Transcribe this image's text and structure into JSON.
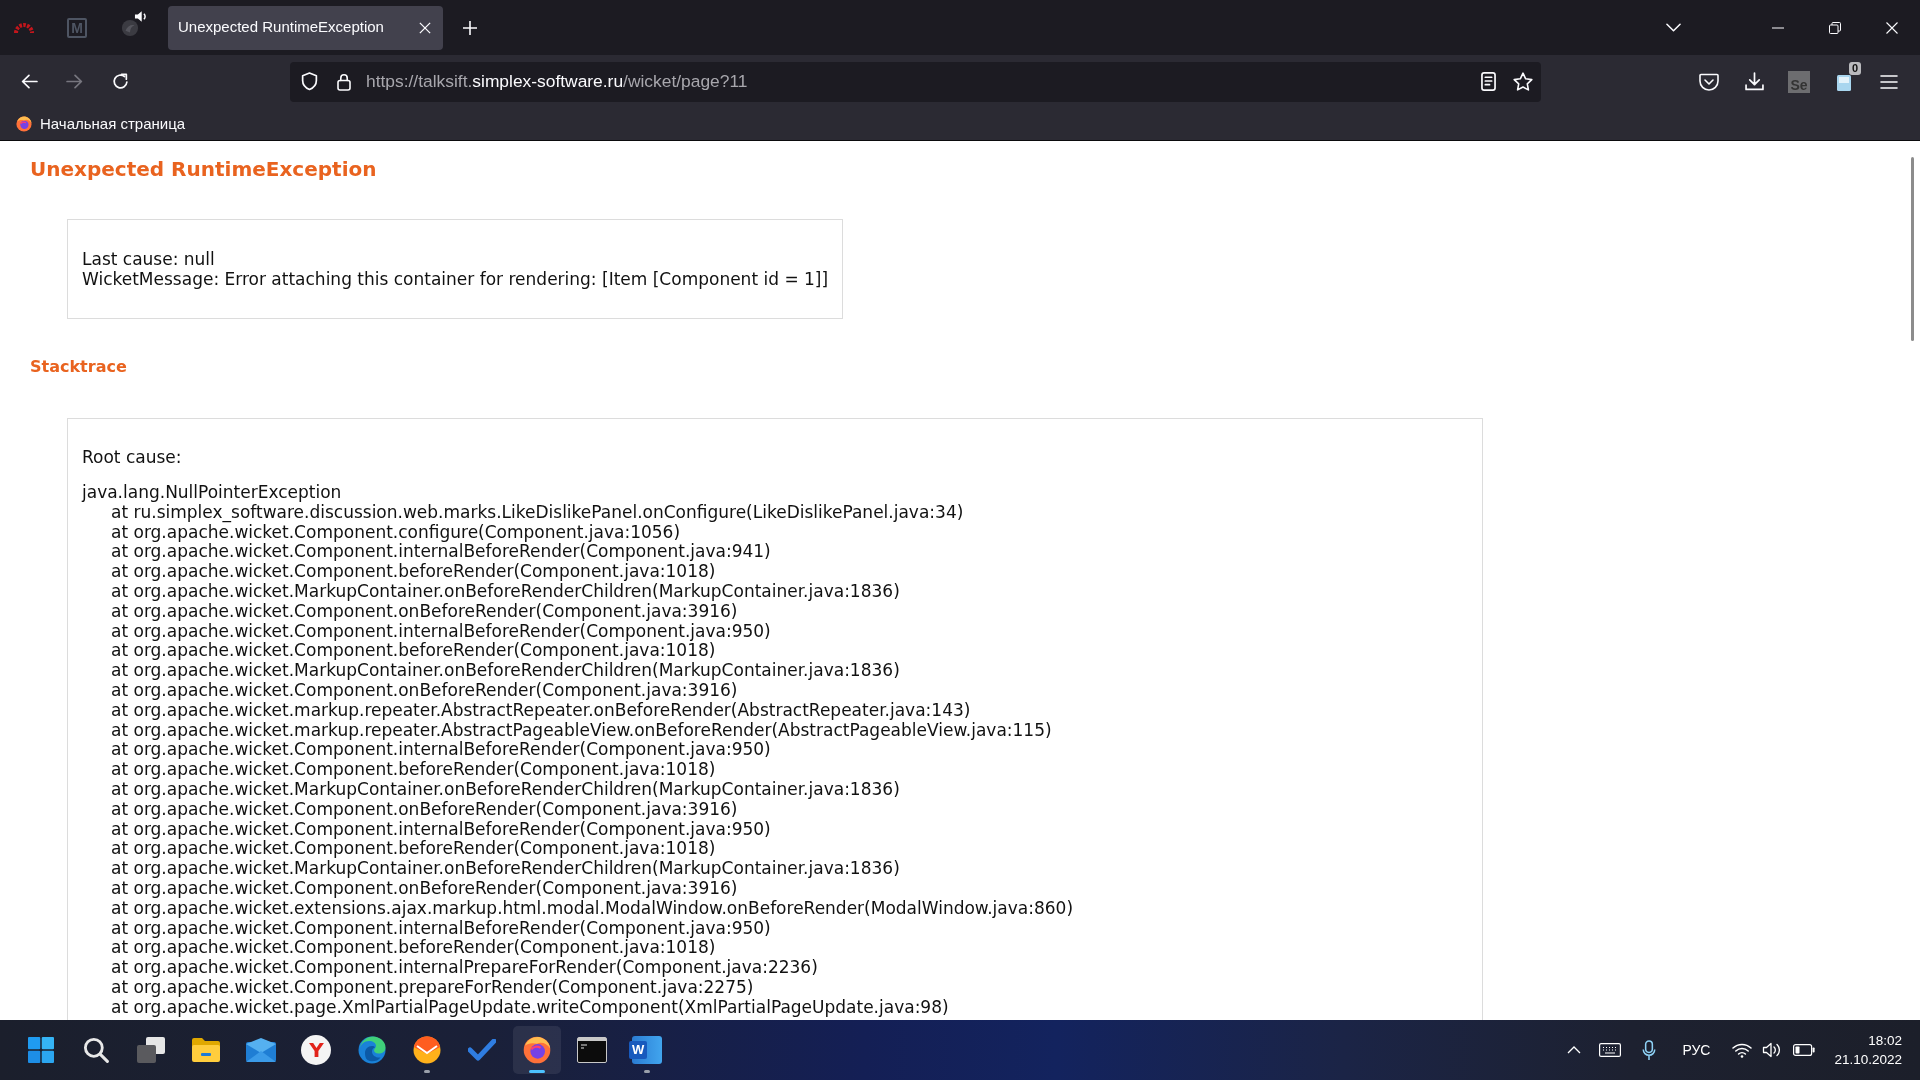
{
  "browser": {
    "tabs": [
      {
        "kind": "pinned",
        "selected": false,
        "sound_playing": false
      },
      {
        "kind": "pinned",
        "selected": false,
        "sound_playing": false,
        "logo_text": "M"
      },
      {
        "kind": "pinned",
        "selected": false,
        "sound_playing": true
      },
      {
        "kind": "page",
        "label": "Unexpected RuntimeException",
        "selected": true
      }
    ],
    "nav_buttons": [
      {
        "kind": "back",
        "disabled": false
      },
      {
        "kind": "forward",
        "disabled": true
      },
      {
        "kind": "reload",
        "disabled": false
      }
    ],
    "address_bar": {
      "url_parts": [
        {
          "text": "https://talksift.",
          "highlight": false
        },
        {
          "text": "simplex-software.ru",
          "highlight": true
        },
        {
          "text": "/wicket/page?11",
          "highlight": false
        }
      ]
    },
    "toolbar_buttons": [
      {
        "kind": "pouch"
      },
      {
        "kind": "download"
      },
      {
        "kind": "letter-extension",
        "logo_text": "Se"
      },
      {
        "kind": "badge-extension",
        "badge": "0"
      },
      {
        "kind": "menu"
      }
    ],
    "bookmarks": [
      {
        "label": "Начальная страница"
      }
    ]
  },
  "page": {
    "title": "Unexpected RuntimeException",
    "message_lines": [
      "Last cause: null",
      "WicketMessage: Error attaching this container for rendering: [Item [Component id = 1]]"
    ],
    "stacktrace_heading": "Stacktrace",
    "root_cause_label": "Root cause:",
    "exception": "java.lang.NullPointerException",
    "frames": [
      "at ru.simplex_software.discussion.web.marks.LikeDislikePanel.onConfigure(LikeDislikePanel.java:34)",
      "at org.apache.wicket.Component.configure(Component.java:1056)",
      "at org.apache.wicket.Component.internalBeforeRender(Component.java:941)",
      "at org.apache.wicket.Component.beforeRender(Component.java:1018)",
      "at org.apache.wicket.MarkupContainer.onBeforeRenderChildren(MarkupContainer.java:1836)",
      "at org.apache.wicket.Component.onBeforeRender(Component.java:3916)",
      "at org.apache.wicket.Component.internalBeforeRender(Component.java:950)",
      "at org.apache.wicket.Component.beforeRender(Component.java:1018)",
      "at org.apache.wicket.MarkupContainer.onBeforeRenderChildren(MarkupContainer.java:1836)",
      "at org.apache.wicket.Component.onBeforeRender(Component.java:3916)",
      "at org.apache.wicket.markup.repeater.AbstractRepeater.onBeforeRender(AbstractRepeater.java:143)",
      "at org.apache.wicket.markup.repeater.AbstractPageableView.onBeforeRender(AbstractPageableView.java:115)",
      "at org.apache.wicket.Component.internalBeforeRender(Component.java:950)",
      "at org.apache.wicket.Component.beforeRender(Component.java:1018)",
      "at org.apache.wicket.MarkupContainer.onBeforeRenderChildren(MarkupContainer.java:1836)",
      "at org.apache.wicket.Component.onBeforeRender(Component.java:3916)",
      "at org.apache.wicket.Component.internalBeforeRender(Component.java:950)",
      "at org.apache.wicket.Component.beforeRender(Component.java:1018)",
      "at org.apache.wicket.MarkupContainer.onBeforeRenderChildren(MarkupContainer.java:1836)",
      "at org.apache.wicket.Component.onBeforeRender(Component.java:3916)",
      "at org.apache.wicket.extensions.ajax.markup.html.modal.ModalWindow.onBeforeRender(ModalWindow.java:860)",
      "at org.apache.wicket.Component.internalBeforeRender(Component.java:950)",
      "at org.apache.wicket.Component.beforeRender(Component.java:1018)",
      "at org.apache.wicket.Component.internalPrepareForRender(Component.java:2236)",
      "at org.apache.wicket.Component.prepareForRender(Component.java:2275)",
      "at org.apache.wicket.page.XmlPartialPageUpdate.writeComponent(XmlPartialPageUpdate.java:98)"
    ]
  },
  "taskbar": {
    "apps": [
      {
        "kind": "tiles",
        "running": false,
        "active": false
      },
      {
        "kind": "search",
        "running": false,
        "active": false
      },
      {
        "kind": "task-view",
        "running": false,
        "active": false
      },
      {
        "kind": "folder",
        "running": false,
        "active": false
      },
      {
        "kind": "mail",
        "running": false,
        "active": false
      },
      {
        "kind": "letter-circle",
        "logo_text": "Y",
        "running": false,
        "active": false
      },
      {
        "kind": "swirl",
        "running": false,
        "active": false
      },
      {
        "kind": "envelope-circle",
        "running": true,
        "active": false
      },
      {
        "kind": "checkmark",
        "running": false,
        "active": false
      },
      {
        "kind": "flame-globe",
        "running": true,
        "active": true
      },
      {
        "kind": "terminal",
        "running": false,
        "active": false
      },
      {
        "kind": "document",
        "logo_text": "W",
        "running": true,
        "active": false
      }
    ],
    "tray": {
      "language": "РУС",
      "time": "18:02",
      "date": "21.10.2022"
    }
  }
}
